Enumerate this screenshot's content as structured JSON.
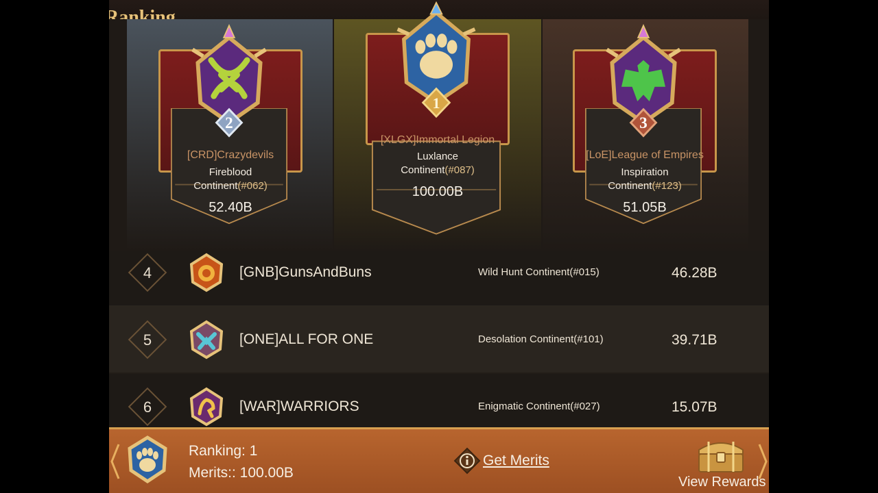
{
  "header": {
    "title": "Ranking"
  },
  "podium": [
    {
      "rank": "2",
      "name": "[CRD]Crazydevils",
      "continent_line1": "Fireblood",
      "continent_word": "Continent",
      "continent_num": "(#062)",
      "score": "52.40B"
    },
    {
      "rank": "1",
      "name": "[XLGX]Immortal Legion",
      "continent_line1": "Luxlance",
      "continent_word": "Continent",
      "continent_num": "(#087)",
      "score": "100.00B"
    },
    {
      "rank": "3",
      "name": "[LoE]League of Empires",
      "continent_line1": "Inspiration",
      "continent_word": "Continent",
      "continent_num": "(#123)",
      "score": "51.05B"
    }
  ],
  "list": [
    {
      "rank": "4",
      "name": "[GNB]GunsAndBuns",
      "continent": "Wild Hunt Continent",
      "continent_num": "(#015)",
      "score": "46.28B"
    },
    {
      "rank": "5",
      "name": "[ONE]ALL FOR ONE",
      "continent": "Desolation Continent",
      "continent_num": "(#101)",
      "score": "39.71B"
    },
    {
      "rank": "6",
      "name": "[WAR]WARRIORS",
      "continent": "Enigmatic Continent",
      "continent_num": "(#027)",
      "score": "15.07B"
    }
  ],
  "footer": {
    "ranking_text": "Ranking: 1",
    "merits_text": "Merits:: 100.00B",
    "get_merits_label": "Get Merits",
    "view_rewards_label": "View Rewards"
  },
  "icons": {
    "rank1_crest": "bear-paw-icon",
    "rank2_crest": "serpent-icon",
    "rank3_crest": "eagle-icon",
    "rank4_crest": "lion-icon",
    "rank5_crest": "wolf-icon",
    "rank6_crest": "griffin-icon",
    "info": "info-icon",
    "chest": "treasure-chest-icon"
  },
  "colors": {
    "accent_gold": "#c8964a",
    "footer_orange": "#b8652e",
    "banner_red": "#7d1d1c",
    "crest_purple": "#5b2a7d",
    "crest_blue": "#2d63a3",
    "crest_green_serpent": "#b4d33c",
    "crest_green_eagle": "#4ec44a"
  }
}
